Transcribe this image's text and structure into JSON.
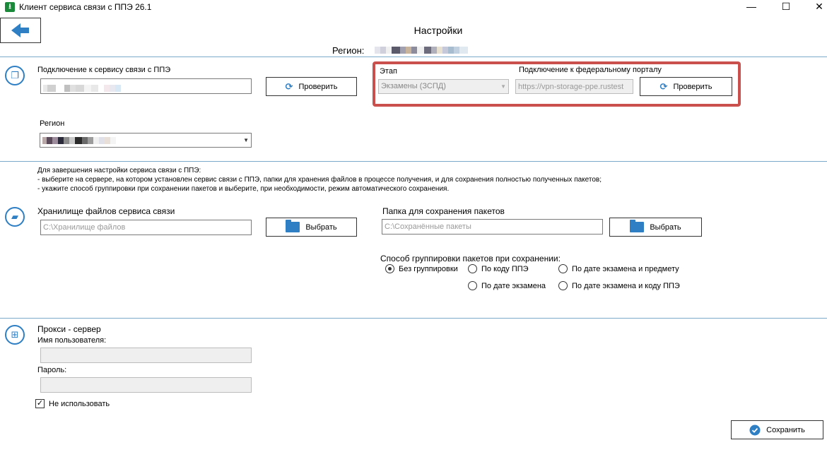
{
  "window": {
    "title": "Клиент сервиса связи с ППЭ 26.1",
    "minimize": "—",
    "maximize": "☐",
    "close": "✕"
  },
  "header": {
    "back_icon": "arrow-left-icon",
    "title": "Настройки",
    "region_label": "Регион:"
  },
  "connection": {
    "label": "Подключение к сервису связи с ППЭ",
    "check_button": "Проверить",
    "stage_label": "Этап",
    "stage_value": "Экзамены (ЗСПД)",
    "federal_label": "Подключение к федеральному порталу",
    "federal_value": "https://vpn-storage-ppe.rustest",
    "federal_check_button": "Проверить",
    "region_label": "Регион"
  },
  "storage": {
    "info_lines": [
      "Для завершения настройки сервиса связи с ППЭ:",
      "- выберите на сервере, на котором установлен сервис связи с ППЭ, папки для хранения файлов в процессе получения, и для сохранения полностью полученных пакетов;",
      "- укажите способ группировки при сохранении пакетов и выберите, при необходимости, режим автоматического сохранения."
    ],
    "files_label": "Хранилище файлов сервиса связи",
    "files_placeholder": "C:\\Хранилище файлов",
    "files_button": "Выбрать",
    "packages_label": "Папка для сохранения пакетов",
    "packages_placeholder": "C:\\Сохранённые пакеты",
    "packages_button": "Выбрать",
    "grouping_label": "Способ группировки пакетов при сохранении:",
    "grouping_options": [
      "Без группировки",
      "По коду ППЭ",
      "По дате экзамена и предмету",
      "По дате экзамена",
      "По дате экзамена и коду ППЭ"
    ],
    "grouping_selected": "Без группировки"
  },
  "proxy": {
    "label": "Прокси - сервер",
    "username_label": "Имя пользователя:",
    "password_label": "Пароль:",
    "not_use_label": "Не использовать",
    "not_use_checked": true
  },
  "footer": {
    "save_button": "Сохранить"
  },
  "colors": {
    "accent": "#2f7fc4",
    "divider": "#7aa9c9",
    "highlight_box": "#c9504c"
  }
}
